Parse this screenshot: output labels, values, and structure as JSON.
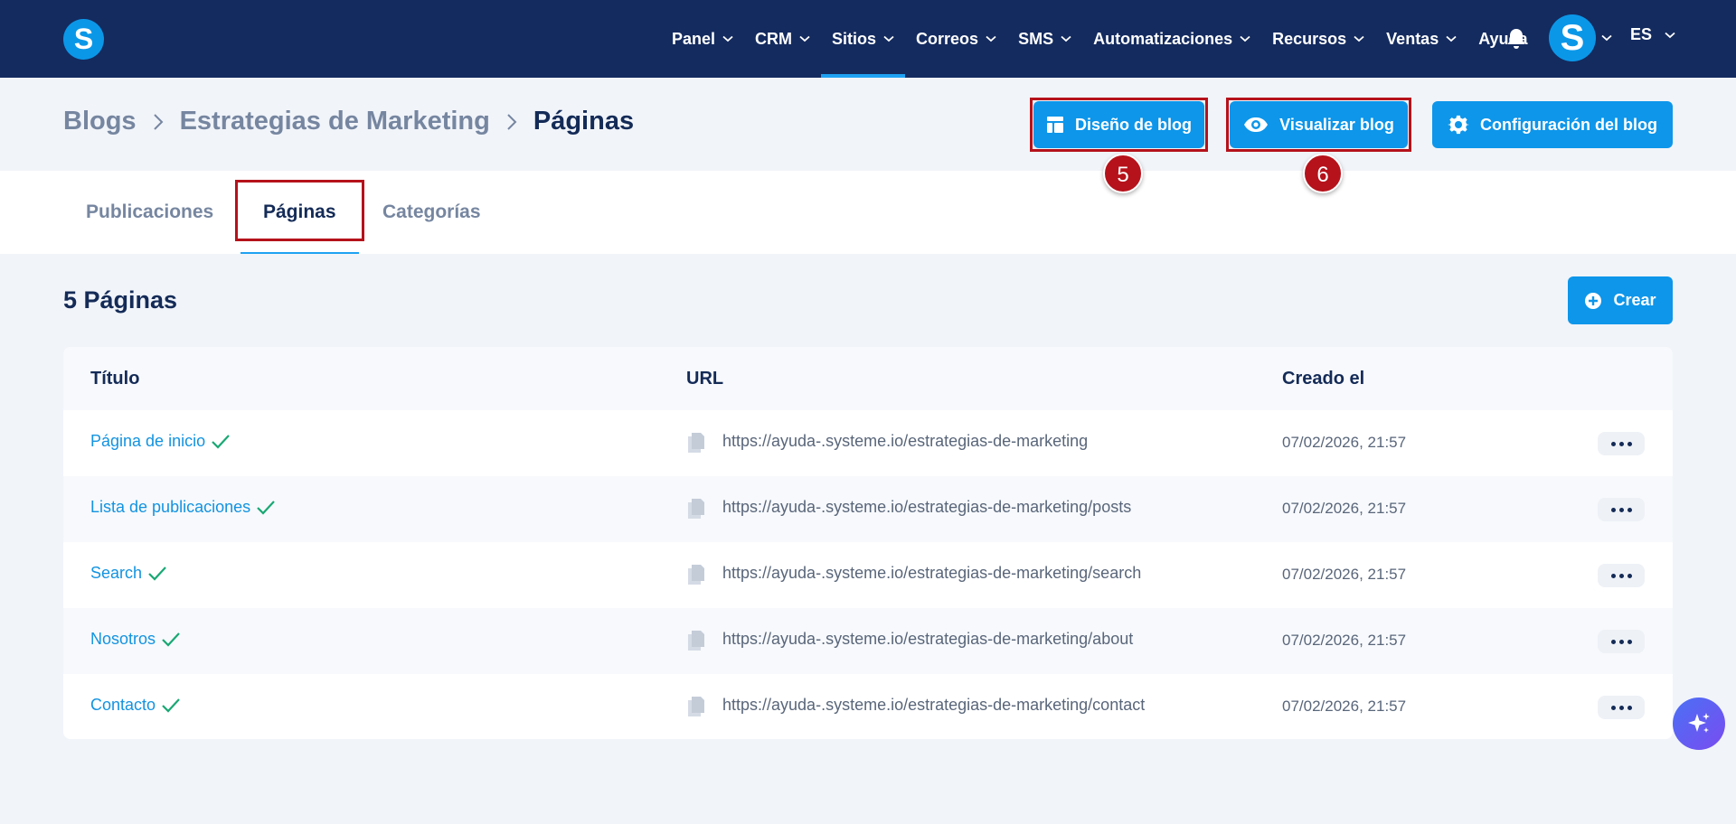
{
  "nav": {
    "logo_letter": "S",
    "items": [
      {
        "label": "Panel",
        "has_dropdown": true,
        "active": false
      },
      {
        "label": "CRM",
        "has_dropdown": true,
        "active": false
      },
      {
        "label": "Sitios",
        "has_dropdown": true,
        "active": true
      },
      {
        "label": "Correos",
        "has_dropdown": true,
        "active": false
      },
      {
        "label": "SMS",
        "has_dropdown": true,
        "active": false
      },
      {
        "label": "Automatizaciones",
        "has_dropdown": true,
        "active": false
      },
      {
        "label": "Recursos",
        "has_dropdown": true,
        "active": false
      },
      {
        "label": "Ventas",
        "has_dropdown": true,
        "active": false
      },
      {
        "label": "Ayuda",
        "has_dropdown": false,
        "active": false
      }
    ],
    "avatar_letter": "S",
    "language": "ES",
    "bg_color": "#142b5f",
    "accent_color": "#1ea2f3"
  },
  "breadcrumb": {
    "items": [
      "Blogs",
      "Estrategias de Marketing",
      "Páginas"
    ]
  },
  "header_buttons": {
    "design": "Diseño de blog",
    "view": "Visualizar blog",
    "config": "Configuración del blog"
  },
  "annotations": {
    "step_design": "5",
    "step_view": "6",
    "highlight_color": "#b5121b"
  },
  "tabs": [
    {
      "label": "Publicaciones",
      "active": false
    },
    {
      "label": "Páginas",
      "active": true
    },
    {
      "label": "Categorías",
      "active": false
    }
  ],
  "content": {
    "count_title": "5 Páginas",
    "create_label": "Crear"
  },
  "table": {
    "headers": {
      "title": "Título",
      "url": "URL",
      "created": "Creado el"
    },
    "rows": [
      {
        "title": "Página de inicio",
        "published": true,
        "url": "https://ayuda-.systeme.io/estrategias-de-marketing",
        "created": "07/02/2026, 21:57"
      },
      {
        "title": "Lista de publicaciones",
        "published": true,
        "url": "https://ayuda-.systeme.io/estrategias-de-marketing/posts",
        "created": "07/02/2026, 21:57"
      },
      {
        "title": "Search",
        "published": true,
        "url": "https://ayuda-.systeme.io/estrategias-de-marketing/search",
        "created": "07/02/2026, 21:57"
      },
      {
        "title": "Nosotros",
        "published": true,
        "url": "https://ayuda-.systeme.io/estrategias-de-marketing/about",
        "created": "07/02/2026, 21:57"
      },
      {
        "title": "Contacto",
        "published": true,
        "url": "https://ayuda-.systeme.io/estrategias-de-marketing/contact",
        "created": "07/02/2026, 21:57"
      }
    ]
  },
  "icons": {
    "bell": "bell-icon",
    "design": "layout-icon",
    "view": "eye-icon",
    "config": "gear-icon",
    "create": "plus-circle-icon",
    "check": "check-icon",
    "doc": "document-copy-icon",
    "more": "more-dots-icon",
    "assistant": "sparkles-icon"
  }
}
